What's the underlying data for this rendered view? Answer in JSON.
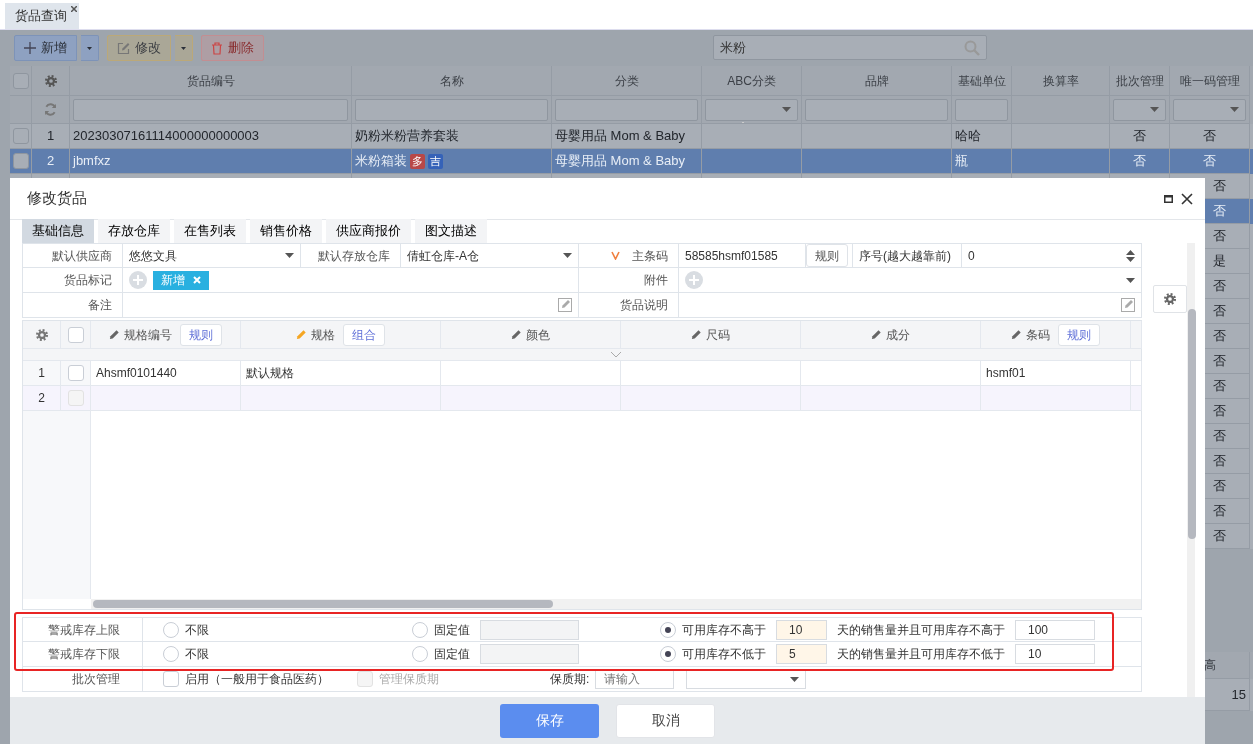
{
  "page_tabs": [
    {
      "label": "货品查询",
      "selected": true
    }
  ],
  "toolbar": {
    "buttons": [
      {
        "label": "新增",
        "kind": "add",
        "has_menu": true
      },
      {
        "label": "修改",
        "kind": "edit",
        "has_menu": true
      },
      {
        "label": "删除",
        "kind": "delete",
        "has_menu": false
      }
    ],
    "search": {
      "value": "米粉"
    }
  },
  "goods_table": {
    "select_all": {
      "checked": false
    },
    "columns": [
      {
        "label": "货品编号",
        "kind": "text"
      },
      {
        "label": "名称",
        "kind": "text"
      },
      {
        "label": "分类",
        "kind": "text"
      },
      {
        "label": "ABC分类",
        "kind": "select"
      },
      {
        "label": "品牌",
        "kind": "text"
      },
      {
        "label": "基础单位",
        "kind": "text"
      },
      {
        "label": "换算率",
        "kind": "none"
      },
      {
        "label": "批次管理",
        "kind": "select"
      },
      {
        "label": "唯一码管理",
        "kind": "select"
      }
    ],
    "rows": [
      {
        "index": "1",
        "selected": false,
        "checked": false,
        "code": "20230307161114000000000003",
        "name": "奶粉米粉营养套装",
        "category": "母婴用品 Mom & Baby",
        "unit": "哈哈",
        "batch": "否",
        "unique": "否"
      },
      {
        "index": "2",
        "selected": true,
        "checked": false,
        "code": "jbmfxz",
        "name": "米粉箱装",
        "tags": [
          {
            "label": "多",
            "color": "#b84848"
          },
          {
            "label": "吉",
            "color": "#3562b8"
          }
        ],
        "category": "母婴用品 Mom & Baby",
        "unit": "瓶",
        "batch": "否",
        "unique": "否"
      }
    ],
    "more_rows": [
      {
        "unique": "否",
        "selected": false
      },
      {
        "unique": "否",
        "selected": true
      },
      {
        "unique": "否",
        "selected": false
      },
      {
        "unique": "是",
        "selected": false
      },
      {
        "unique": "否",
        "selected": false
      },
      {
        "unique": "否",
        "selected": false
      },
      {
        "unique": "否",
        "selected": false
      },
      {
        "unique": "否",
        "selected": false
      },
      {
        "unique": "否",
        "selected": false
      },
      {
        "unique": "否",
        "selected": false
      },
      {
        "unique": "否",
        "selected": false
      },
      {
        "unique": "否",
        "selected": false
      },
      {
        "unique": "否",
        "selected": false
      },
      {
        "unique": "否",
        "selected": false
      },
      {
        "unique": "否",
        "selected": false
      }
    ]
  },
  "bottom_panel": {
    "header": "高",
    "value": "15"
  },
  "dialog": {
    "title": "修改货品",
    "tabs": [
      {
        "label": "基础信息",
        "selected": true
      },
      {
        "label": "存放仓库",
        "selected": false
      },
      {
        "label": "在售列表",
        "selected": false
      },
      {
        "label": "销售价格",
        "selected": false
      },
      {
        "label": "供应商报价",
        "selected": false
      },
      {
        "label": "图文描述",
        "selected": false
      }
    ],
    "supplier": {
      "label": "默认供应商",
      "value": "悠悠文具"
    },
    "warehouse": {
      "label": "默认存放仓库",
      "value": "倩虹仓库-A仓"
    },
    "barcode": {
      "label": "主条码",
      "value": "58585hsmf01585",
      "button": "规则"
    },
    "sort": {
      "label": "序号(越大越靠前)",
      "value": "0"
    },
    "tags": {
      "label": "货品标记",
      "items": [
        {
          "label": "新增",
          "color": "#29b0e0"
        }
      ]
    },
    "attachment": {
      "label": "附件"
    },
    "remark": {
      "label": "备注"
    },
    "description": {
      "label": "货品说明"
    },
    "spec_grid": {
      "select_all": {
        "checked": false
      },
      "columns": [
        {
          "label": "规格编号",
          "color": "#666666",
          "button": "规则"
        },
        {
          "label": "规格",
          "color": "#f5a623",
          "button": "组合"
        },
        {
          "label": "颜色",
          "color": "#666666"
        },
        {
          "label": "尺码",
          "color": "#666666"
        },
        {
          "label": "成分",
          "color": "#666666"
        },
        {
          "label": "条码",
          "color": "#666666",
          "button": "规则"
        }
      ],
      "rows": [
        {
          "index": "1",
          "selected": false,
          "checked": false,
          "code": "Ahsmf0101440",
          "spec": "默认规格",
          "barcode": "hsmf01"
        },
        {
          "index": "2",
          "selected": true,
          "checked": false
        }
      ]
    },
    "stock_limits": {
      "highlighted": true,
      "rows": [
        {
          "label": "警戒库存上限",
          "options": [
            {
              "label": "不限",
              "selected": false
            },
            {
              "label": "固定值",
              "selected": false
            },
            {
              "label": "可用库存不高于",
              "selected": true
            }
          ],
          "days": "10",
          "days_text": "天的销售量并且可用库存不高于",
          "limit": "100"
        },
        {
          "label": "警戒库存下限",
          "options": [
            {
              "label": "不限",
              "selected": false
            },
            {
              "label": "固定值",
              "selected": false
            },
            {
              "label": "可用库存不低于",
              "selected": true
            }
          ],
          "days": "5",
          "days_text": "天的销售量并且可用库存不低于",
          "limit": "10"
        }
      ]
    },
    "batch": {
      "label": "批次管理",
      "enable": {
        "label": "启用（一般用于食品医药）",
        "checked": false
      },
      "shelf_life_manage": {
        "label": "管理保质期",
        "checked": false,
        "disabled": true
      },
      "shelf_life": {
        "label": "保质期:",
        "placeholder": "请输入"
      }
    },
    "buttons": [
      {
        "label": "保存",
        "kind": "primary"
      },
      {
        "label": "取消",
        "kind": "secondary"
      }
    ]
  }
}
